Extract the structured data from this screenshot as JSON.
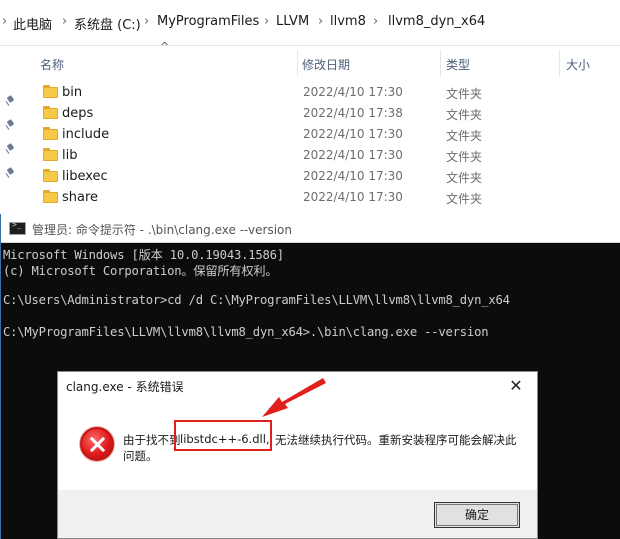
{
  "explorer": {
    "breadcrumb": [
      "此电脑",
      "系统盘 (C:)",
      "MyProgramFiles",
      "LLVM",
      "llvm8",
      "llvm8_dyn_x64"
    ],
    "breadcrumb_separator": "›",
    "columns": {
      "name": "名称",
      "modified": "修改日期",
      "type": "类型",
      "size": "大小"
    },
    "files": [
      {
        "name": "bin",
        "modified": "2022/4/10 17:30",
        "type": "文件夹"
      },
      {
        "name": "deps",
        "modified": "2022/4/10 17:38",
        "type": "文件夹"
      },
      {
        "name": "include",
        "modified": "2022/4/10 17:30",
        "type": "文件夹"
      },
      {
        "name": "lib",
        "modified": "2022/4/10 17:30",
        "type": "文件夹"
      },
      {
        "name": "libexec",
        "modified": "2022/4/10 17:30",
        "type": "文件夹"
      },
      {
        "name": "share",
        "modified": "2022/4/10 17:30",
        "type": "文件夹"
      }
    ]
  },
  "console": {
    "title": "管理员: 命令提示符 - .\\bin\\clang.exe  --version",
    "lines": [
      "Microsoft Windows [版本 10.0.19043.1586]",
      "(c) Microsoft Corporation。保留所有权利。",
      "C:\\Users\\Administrator>cd /d C:\\MyProgramFiles\\LLVM\\llvm8\\llvm8_dyn_x64",
      "C:\\MyProgramFiles\\LLVM\\llvm8\\llvm8_dyn_x64>.\\bin\\clang.exe --version"
    ]
  },
  "dialog": {
    "title": "clang.exe - 系统错误",
    "close_glyph": "✕",
    "message_prefix": "由于找不到",
    "message_dll": "libstdc++-6.dll,",
    "message_suffix": "无法继续执行代码。重新安装程序可能会解决此",
    "message_line2": "问题。",
    "ok_label": "确定"
  },
  "colors": {
    "annotation": "#e0201c",
    "folder": "#f7c948",
    "console_bg": "#0c0c0c",
    "console_text": "#cccccc"
  }
}
